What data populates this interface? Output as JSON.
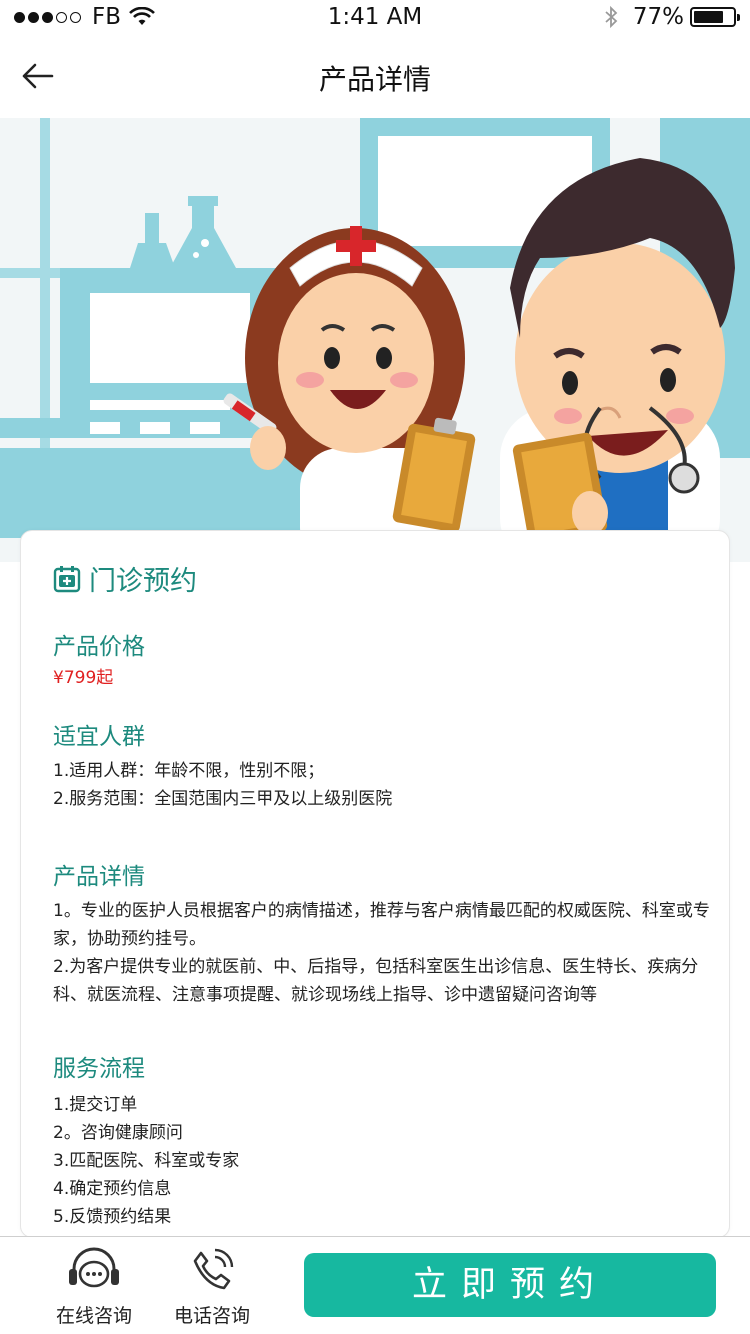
{
  "status_bar": {
    "carrier": "FB",
    "time": "1:41 AM",
    "battery": "77%",
    "battery_level": 0.77,
    "signal_filled": 3,
    "signal_total": 5
  },
  "nav": {
    "title": "产品详情",
    "back_icon": "arrow-left-icon"
  },
  "colors": {
    "accent": "#1d8a7e",
    "button": "#17b8a0",
    "price": "#e02020"
  },
  "card": {
    "icon": "calendar-plus-icon",
    "title": "门诊预约",
    "price_title": "产品价格",
    "price": "¥799起",
    "audience_title": "适宜人群",
    "audience_lines": [
      "1.适用人群：年龄不限，性别不限；",
      "2.服务范围：全国范围内三甲及以上级别医院"
    ],
    "detail_title": "产品详情",
    "detail_lines": [
      "1。专业的医护人员根据客户的病情描述，推荐与客户病情最匹配的权威医院、科室或专家，协助预约挂号。",
      "2.为客户提供专业的就医前、中、后指导，包括科室医生出诊信息、医生特长、疾病分科、就医流程、注意事项提醒、就诊现场线上指导、诊中遗留疑问咨询等"
    ],
    "process_title": "服务流程",
    "process_steps": [
      "1.提交订单",
      "2。咨询健康顾问",
      "3.匹配医院、科室或专家",
      "4.确定预约信息",
      "5.反馈预约结果"
    ]
  },
  "bottom": {
    "online_label": "在线咨询",
    "online_icon": "headset-chat-icon",
    "phone_label": "电话咨询",
    "phone_icon": "phone-icon",
    "book_label": "立即预约"
  }
}
